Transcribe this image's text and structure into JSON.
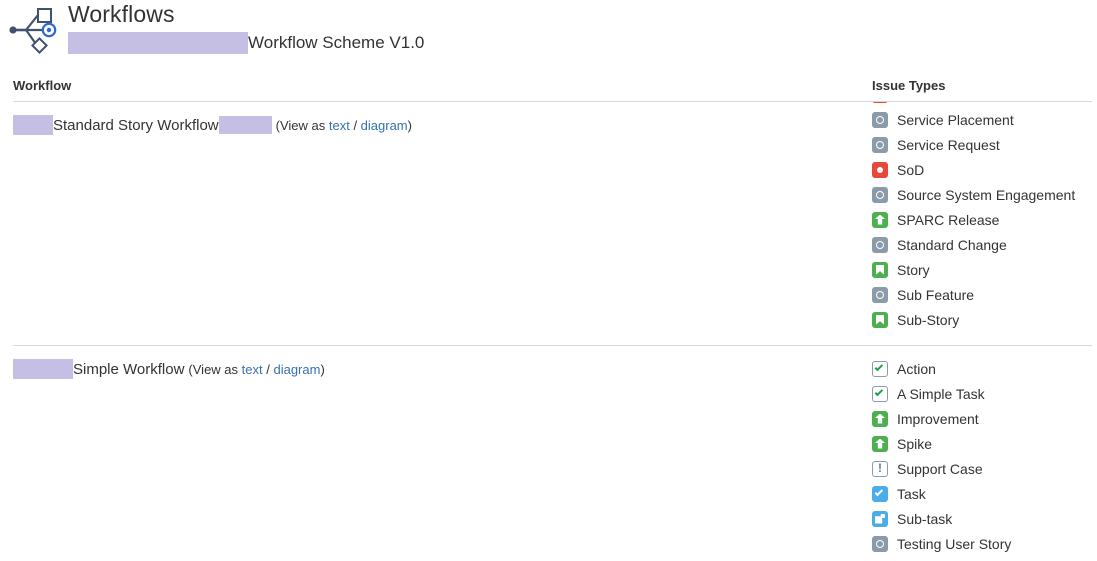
{
  "header": {
    "icon": "workflow-scheme-icon",
    "title": "Workflows",
    "scheme_name": "Workflow Scheme V1.0"
  },
  "columns": {
    "workflow": "Workflow",
    "issue_types": "Issue Types"
  },
  "view_as": {
    "prefix": "(View as ",
    "text_link": "text",
    "separator": " / ",
    "diagram_link": "diagram",
    "suffix": ")"
  },
  "colors": {
    "redaction": "#c5bfe3",
    "link": "#3572b0",
    "rule": "#d8d8d8",
    "icon_gray": "#8c9baa",
    "icon_red": "#e5493a",
    "icon_green": "#4caf50",
    "icon_blue": "#4bade8",
    "check_green": "#22a045"
  },
  "rows": [
    {
      "name": "Standard Story Workflow",
      "issue_types": [
        {
          "label": "Service Placement",
          "icon": "gray-circle-icon"
        },
        {
          "label": "Service Request",
          "icon": "gray-circle-icon"
        },
        {
          "label": "SoD",
          "icon": "red-dot-icon"
        },
        {
          "label": "Source System Engagement",
          "icon": "gray-circle-icon"
        },
        {
          "label": "SPARC Release",
          "icon": "green-up-arrow-icon"
        },
        {
          "label": "Standard Change",
          "icon": "gray-circle-icon"
        },
        {
          "label": "Story",
          "icon": "green-bookmark-icon"
        },
        {
          "label": "Sub Feature",
          "icon": "gray-circle-icon"
        },
        {
          "label": "Sub-Story",
          "icon": "green-bookmark-icon"
        }
      ]
    },
    {
      "name": "Simple Workflow",
      "issue_types": [
        {
          "label": "Action",
          "icon": "outline-check-icon"
        },
        {
          "label": "A Simple Task",
          "icon": "outline-check-icon"
        },
        {
          "label": "Improvement",
          "icon": "green-up-arrow-icon"
        },
        {
          "label": "Spike",
          "icon": "green-up-arrow-icon"
        },
        {
          "label": "Support Case",
          "icon": "exclamation-icon"
        },
        {
          "label": "Task",
          "icon": "blue-check-icon"
        },
        {
          "label": "Sub-task",
          "icon": "blue-subtask-icon"
        },
        {
          "label": "Testing User Story",
          "icon": "gray-circle-icon"
        }
      ]
    }
  ]
}
